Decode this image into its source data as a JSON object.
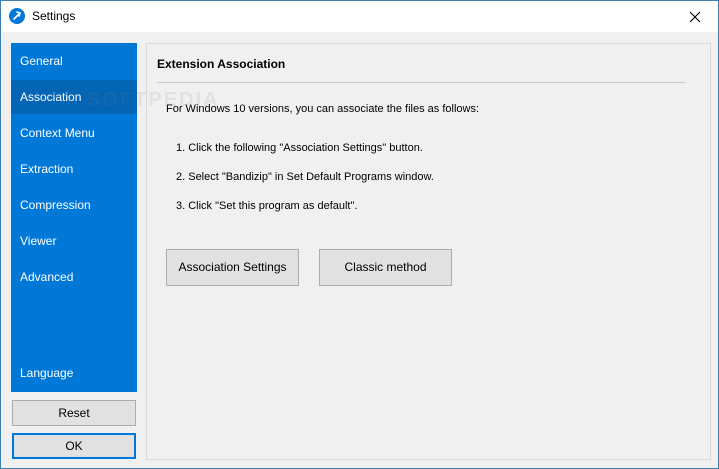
{
  "window": {
    "title": "Settings",
    "accent_color": "#0078d7"
  },
  "sidebar": {
    "items": [
      {
        "label": "General"
      },
      {
        "label": "Association",
        "active": true
      },
      {
        "label": "Context Menu"
      },
      {
        "label": "Extraction"
      },
      {
        "label": "Compression"
      },
      {
        "label": "Viewer"
      },
      {
        "label": "Advanced"
      },
      {
        "label": "Language"
      }
    ]
  },
  "buttons": {
    "reset": "Reset",
    "ok": "OK"
  },
  "panel": {
    "title": "Extension Association",
    "intro": "For Windows 10 versions, you can associate the files as follows:",
    "steps": [
      "1. Click the following \"Association Settings\" button.",
      "2. Select \"Bandizip\" in Set Default Programs window.",
      "3. Click \"Set this program as default\"."
    ],
    "association_settings_label": "Association Settings",
    "classic_method_label": "Classic method"
  },
  "watermark": "SOFTPEDIA"
}
